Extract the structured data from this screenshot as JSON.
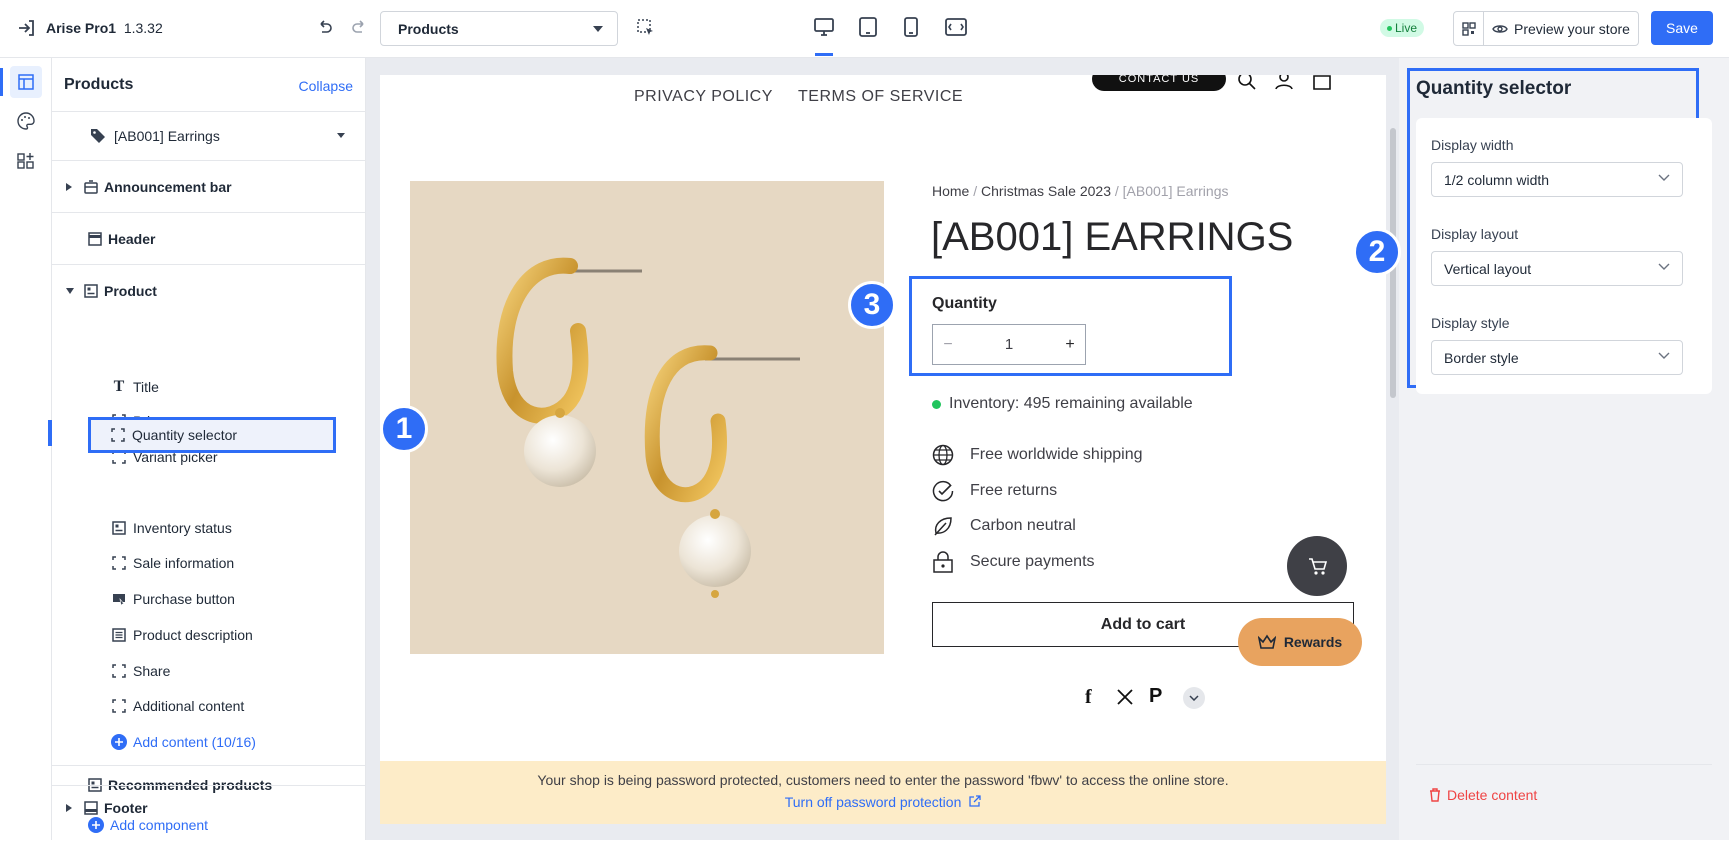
{
  "app": {
    "name": "Arise Pro1",
    "version": "1.3.32"
  },
  "toolbar": {
    "page_select": "Products",
    "live_label": "Live",
    "preview_label": "Preview your store",
    "save_label": "Save"
  },
  "panel": {
    "title": "Products",
    "collapse_label": "Collapse",
    "product_select": "[AB001] Earrings",
    "sections": {
      "announcement": "Announcement bar",
      "header": "Header",
      "product": "Product",
      "recommended": "Recommended products",
      "add_component": "Add component",
      "footer": "Footer"
    },
    "product_children": [
      {
        "label": "Title"
      },
      {
        "label": "Price"
      },
      {
        "label": "Variant picker"
      },
      {
        "label": "Quantity selector"
      },
      {
        "label": "Inventory status"
      },
      {
        "label": "Sale information"
      },
      {
        "label": "Purchase button"
      },
      {
        "label": "Product description"
      },
      {
        "label": "Share"
      },
      {
        "label": "Additional content"
      }
    ],
    "add_content": "Add content (10/16)"
  },
  "preview": {
    "nav": [
      "PRIVACY POLICY",
      "TERMS OF SERVICE"
    ],
    "contact_btn": "CONTACT US",
    "breadcrumb": {
      "home": "Home",
      "sep": "/",
      "collection": "Christmas Sale 2023",
      "current": "[AB001] Earrings"
    },
    "product_title": "[AB001] EARRINGS",
    "quantity_label": "Quantity",
    "quantity_value": "1",
    "minus": "−",
    "plus": "+",
    "inventory": "Inventory: 495 remaining available",
    "features": [
      "Free worldwide shipping",
      "Free returns",
      "Carbon neutral",
      "Secure payments"
    ],
    "add_to_cart": "Add to cart",
    "rewards": "Rewards",
    "banner_text": "Your shop is being password protected, customers need to enter the password 'fbwv' to access the online store.",
    "banner_link": "Turn off password protection"
  },
  "settings": {
    "title": "Quantity selector",
    "width_label": "Display width",
    "width_value": "1/2 column width",
    "layout_label": "Display layout",
    "layout_value": "Vertical layout",
    "style_label": "Display style",
    "style_value": "Border style",
    "delete_label": "Delete content"
  },
  "badges": [
    "1",
    "2",
    "3"
  ],
  "colors": {
    "accent": "#2f6df6",
    "live": "#22c55e",
    "rewards": "#e8a35f",
    "banner": "#fdecc8",
    "danger": "#ef4444"
  }
}
